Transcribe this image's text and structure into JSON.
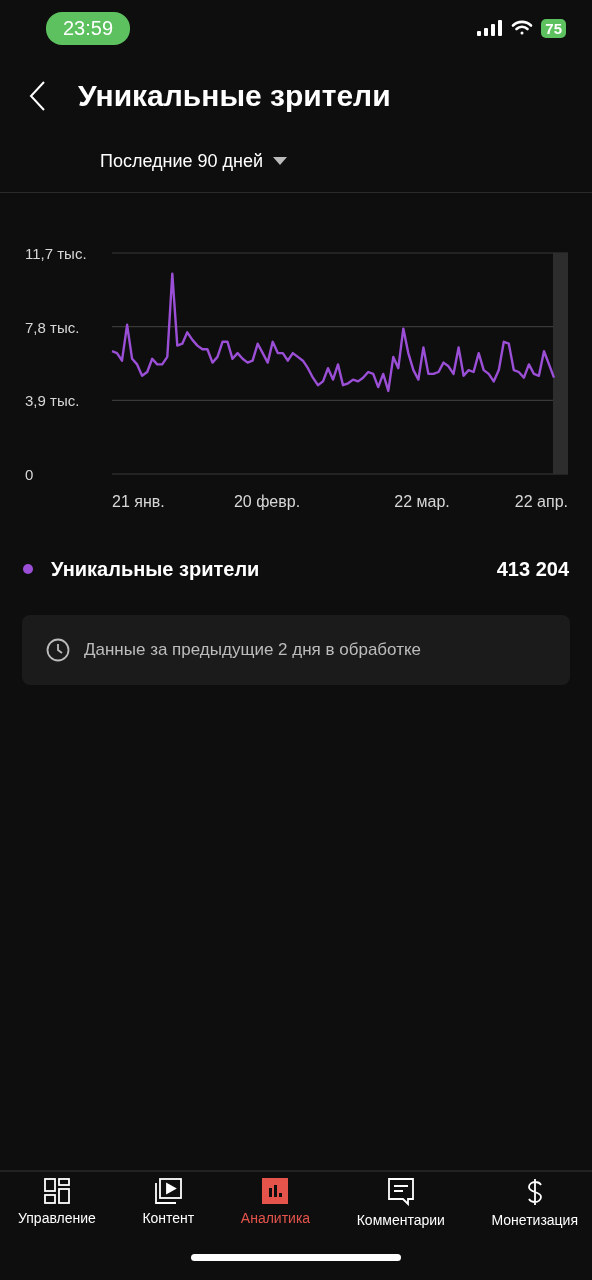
{
  "status_bar": {
    "time": "23:59",
    "battery": "75"
  },
  "header": {
    "title": "Уникальные зрители"
  },
  "period": {
    "label": "Последние 90 дней"
  },
  "chart": {
    "x_axis_labels": [
      "21 янв.",
      "20 февр.",
      "22 мар.",
      "22 апр."
    ],
    "chart_data": {
      "type": "line",
      "ylim": [
        0,
        11.7
      ],
      "yticks": [
        {
          "value": 0,
          "label": "0"
        },
        {
          "value": 3.9,
          "label": "3,9 тыс."
        },
        {
          "value": 7.8,
          "label": "7,8 тыс."
        },
        {
          "value": 11.7,
          "label": "11,7 тыс."
        }
      ],
      "series": [
        {
          "color": "#9b4fd6",
          "values": [
            6.5,
            6.4,
            6.0,
            7.9,
            6.1,
            5.8,
            5.2,
            5.4,
            6.1,
            5.8,
            5.8,
            6.2,
            10.6,
            6.8,
            6.9,
            7.5,
            7.1,
            6.8,
            6.6,
            6.6,
            5.9,
            6.2,
            7.0,
            7.0,
            6.1,
            6.4,
            6.1,
            5.9,
            6.0,
            6.9,
            6.4,
            5.9,
            7.0,
            6.4,
            6.4,
            6.0,
            6.4,
            6.2,
            6.0,
            5.6,
            5.1,
            4.7,
            4.9,
            5.6,
            5.0,
            5.8,
            4.7,
            4.8,
            5.0,
            4.9,
            5.1,
            5.4,
            5.3,
            4.6,
            5.3,
            4.4,
            6.2,
            5.6,
            7.7,
            6.4,
            5.5,
            5.0,
            6.7,
            5.3,
            5.3,
            5.4,
            5.9,
            5.7,
            5.3,
            6.7,
            5.2,
            5.5,
            5.4,
            6.4,
            5.5,
            5.3,
            4.9,
            5.5,
            7.0,
            6.9,
            5.5,
            5.4,
            5.1,
            5.8,
            5.3,
            5.2,
            6.5,
            5.8,
            5.1
          ]
        }
      ]
    }
  },
  "legend": {
    "name": "Уникальные зрители",
    "color": "#9b4fd6",
    "total": "413 204"
  },
  "notice": {
    "text": "Данные за предыдущие 2 дня в обработке"
  },
  "nav": [
    {
      "kind": "dashboard",
      "label": "Управление",
      "selected": false
    },
    {
      "kind": "content",
      "label": "Контент",
      "selected": false
    },
    {
      "kind": "analytics",
      "label": "Аналитика",
      "selected": true
    },
    {
      "kind": "comments",
      "label": "Комментарии",
      "selected": false
    },
    {
      "kind": "money",
      "label": "Монетизация",
      "selected": false
    }
  ]
}
